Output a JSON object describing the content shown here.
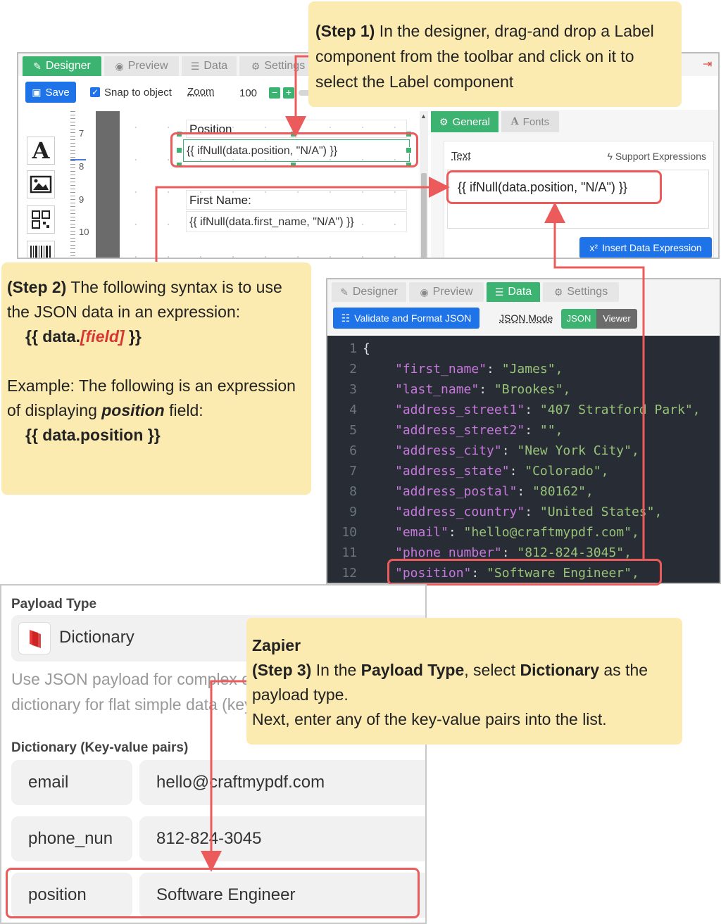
{
  "designer": {
    "tabs": [
      {
        "label": "Designer",
        "active": true
      },
      {
        "label": "Preview"
      },
      {
        "label": "Data"
      },
      {
        "label": "Settings"
      }
    ],
    "save_label": "Save",
    "snap_label": "Snap to object",
    "snap_checked": true,
    "zoom_label": "Zoom",
    "zoom_value": "100",
    "ruler_numbers": [
      "7",
      "8",
      "9",
      "10"
    ],
    "canvas": {
      "position_label": "Position",
      "position_expr": "{{ ifNull(data.position, \"N/A\") }}",
      "first_name_label": "First Name:",
      "first_name_expr": "{{ ifNull(data.first_name, \"N/A\") }}"
    },
    "props": {
      "tabs": [
        {
          "label": "General",
          "active": true
        },
        {
          "label": "Fonts"
        }
      ],
      "text_label": "Text",
      "support_expr_label": "Support Expressions",
      "text_value": "{{ ifNull(data.position, \"N/A\") }}",
      "insert_button": "Insert Data Expression"
    }
  },
  "data_panel": {
    "tabs": [
      {
        "label": "Designer"
      },
      {
        "label": "Preview"
      },
      {
        "label": "Data",
        "active": true
      },
      {
        "label": "Settings"
      }
    ],
    "validate_button": "Validate and Format JSON",
    "json_mode_label": "JSON Mode",
    "json_btn": "JSON",
    "viewer_btn": "Viewer",
    "lines": [
      {
        "n": "1",
        "text": "{"
      },
      {
        "n": "2",
        "key": "\"first_name\"",
        "value": "\"James\","
      },
      {
        "n": "3",
        "key": "\"last_name\"",
        "value": "\"Brookes\","
      },
      {
        "n": "4",
        "key": "\"address_street1\"",
        "value": "\"407 Stratford Park\","
      },
      {
        "n": "5",
        "key": "\"address_street2\"",
        "value": "\"\","
      },
      {
        "n": "6",
        "key": "\"address_city\"",
        "value": "\"New York City\","
      },
      {
        "n": "7",
        "key": "\"address_state\"",
        "value": "\"Colorado\","
      },
      {
        "n": "8",
        "key": "\"address_postal\"",
        "value": "\"80162\","
      },
      {
        "n": "9",
        "key": "\"address_country\"",
        "value": "\"United States\","
      },
      {
        "n": "10",
        "key": "\"email\"",
        "value": "\"hello@craftmypdf.com\","
      },
      {
        "n": "11",
        "key": "\"phone_number\"",
        "value": "\"812-824-3045\","
      },
      {
        "n": "12",
        "key": "\"position\"",
        "value": "\"Software Engineer\","
      }
    ]
  },
  "zapier": {
    "payload_type_label": "Payload Type",
    "payload_value": "Dictionary",
    "help_line1": "Use JSON payload for complex data. Otherwise, select",
    "help_line2": "dictionary for flat simple data (key-value pairs)",
    "dict_label": "Dictionary (Key-value pairs)",
    "pairs": [
      {
        "key": "email",
        "value": "hello@craftmypdf.com"
      },
      {
        "key": "phone_nun",
        "value": "812-824-3045"
      },
      {
        "key": "position",
        "value": "Software Engineer"
      }
    ]
  },
  "callouts": {
    "step1": {
      "bold": "(Step 1)",
      "text": " In the designer, drag-and drop a Label component from the toolbar and click on it to select the Label component"
    },
    "step2": {
      "bold": "(Step 2)",
      "text": "  The following syntax is to use the JSON data in an expression:",
      "syntax_pre": "{{ data.",
      "syntax_field": "[field]",
      "syntax_post": " }}",
      "example_pre": "Example: The following is an expression of displaying ",
      "example_bold": "position",
      "example_post": " field:",
      "example_code": "{{ data.position }}"
    },
    "step3": {
      "title": "Zapier",
      "bold": "(Step 3)",
      "t1": " In the ",
      "b1": "Payload Type",
      "t2": ", select ",
      "b2": "Dictionary",
      "t3": " as the payload type.",
      "line2": "Next, enter any of the key-value pairs into the list."
    }
  },
  "colors": {
    "accent_green": "#3cb371",
    "button_blue": "#1e73e8",
    "highlight_red": "#ec5b5b",
    "callout_yellow": "#fcebb0",
    "editor_bg": "#282c34"
  }
}
